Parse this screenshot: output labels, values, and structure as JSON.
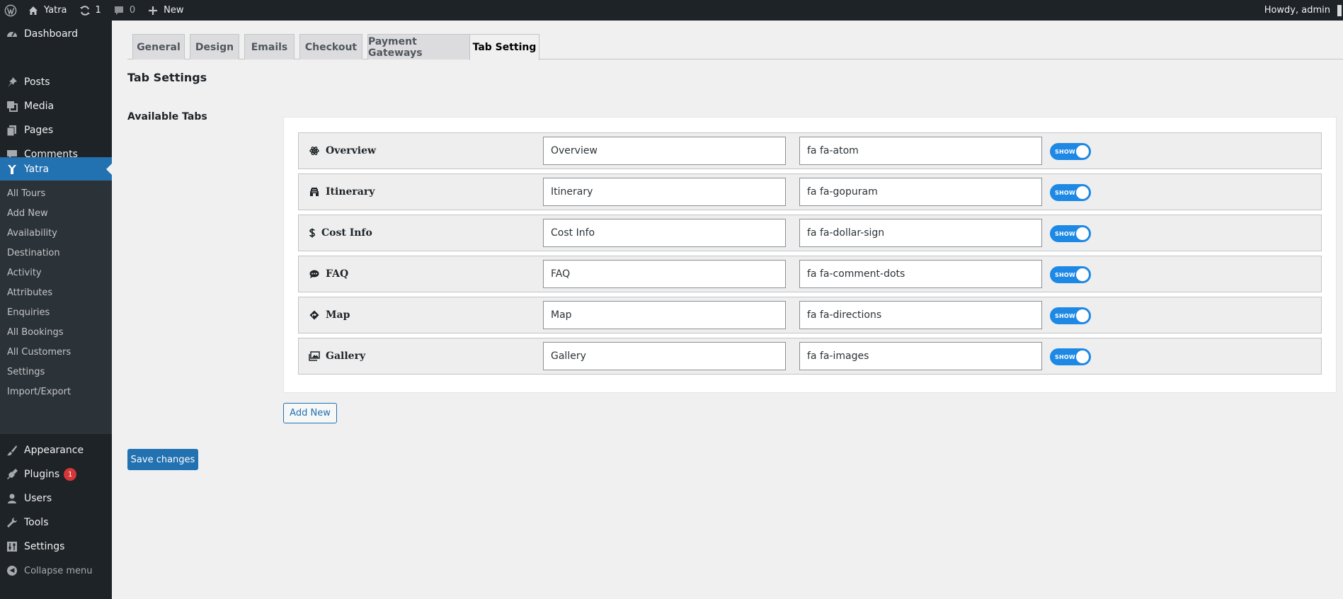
{
  "adminbar": {
    "site_name": "Yatra",
    "updates_count": "1",
    "comments_count": "0",
    "new_label": "New",
    "greeting": "Howdy, admin"
  },
  "sidebar": {
    "dashboard": "Dashboard",
    "posts": "Posts",
    "media": "Media",
    "pages": "Pages",
    "comments": "Comments",
    "yatra": "Yatra",
    "submenu": [
      "All Tours",
      "Add New",
      "Availability",
      "Destination",
      "Activity",
      "Attributes",
      "Enquiries",
      "All Bookings",
      "All Customers",
      "Settings",
      "Import/Export"
    ],
    "appearance": "Appearance",
    "plugins": "Plugins",
    "plugins_badge": "1",
    "users": "Users",
    "tools": "Tools",
    "settings": "Settings",
    "collapse": "Collapse menu"
  },
  "tabs": [
    "General",
    "Design",
    "Emails",
    "Checkout",
    "Payment Gateways",
    "Tab Setting"
  ],
  "active_tab": "Tab Setting",
  "page": {
    "heading": "Tab Settings",
    "available_label": "Available Tabs",
    "add_new": "Add New",
    "save": "Save changes"
  },
  "rows": [
    {
      "title": "Overview",
      "label_value": "Overview",
      "icon_value": "fa fa-atom",
      "toggle": "SHOW",
      "icon": "atom-icon"
    },
    {
      "title": "Itinerary",
      "label_value": "Itinerary",
      "icon_value": "fa fa-gopuram",
      "toggle": "SHOW",
      "icon": "gopuram-icon"
    },
    {
      "title": "Cost Info",
      "label_value": "Cost Info",
      "icon_value": "fa fa-dollar-sign",
      "toggle": "SHOW",
      "icon": "dollar-sign-icon"
    },
    {
      "title": "FAQ",
      "label_value": "FAQ",
      "icon_value": "fa fa-comment-dots",
      "toggle": "SHOW",
      "icon": "comment-dots-icon"
    },
    {
      "title": "Map",
      "label_value": "Map",
      "icon_value": "fa fa-directions",
      "toggle": "SHOW",
      "icon": "directions-icon"
    },
    {
      "title": "Gallery",
      "label_value": "Gallery",
      "icon_value": "fa fa-images",
      "toggle": "SHOW",
      "icon": "images-icon"
    }
  ],
  "colors": {
    "admin_bg": "#1d2327",
    "accent": "#2271b1",
    "toggle_on": "#1e88e5",
    "badge": "#d63638"
  }
}
